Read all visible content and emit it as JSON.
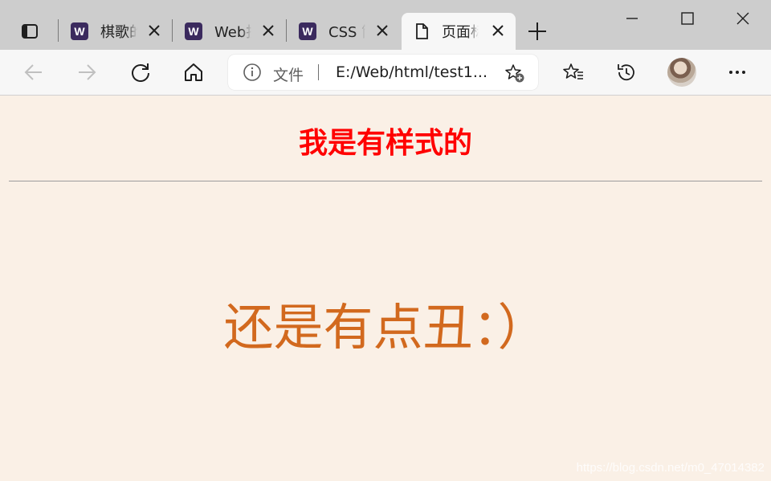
{
  "browser": {
    "tabs": [
      {
        "favicon": "W",
        "title": "棋歌的",
        "active": false
      },
      {
        "favicon": "W",
        "title": "Web技",
        "active": false
      },
      {
        "favicon": "W",
        "title": "CSS 筒",
        "active": false
      },
      {
        "favicon": "page-icon",
        "title": "页面标",
        "active": true
      }
    ],
    "address": {
      "scheme_label": "文件",
      "url": "E:/Web/html/test1..."
    }
  },
  "page": {
    "heading": "我是有样式的",
    "body_text": "还是有点丑：）",
    "heading_color": "#ff0000",
    "body_color": "#d2691e",
    "background": "#faf0e6"
  },
  "watermark": "https://blog.csdn.net/m0_47014382"
}
